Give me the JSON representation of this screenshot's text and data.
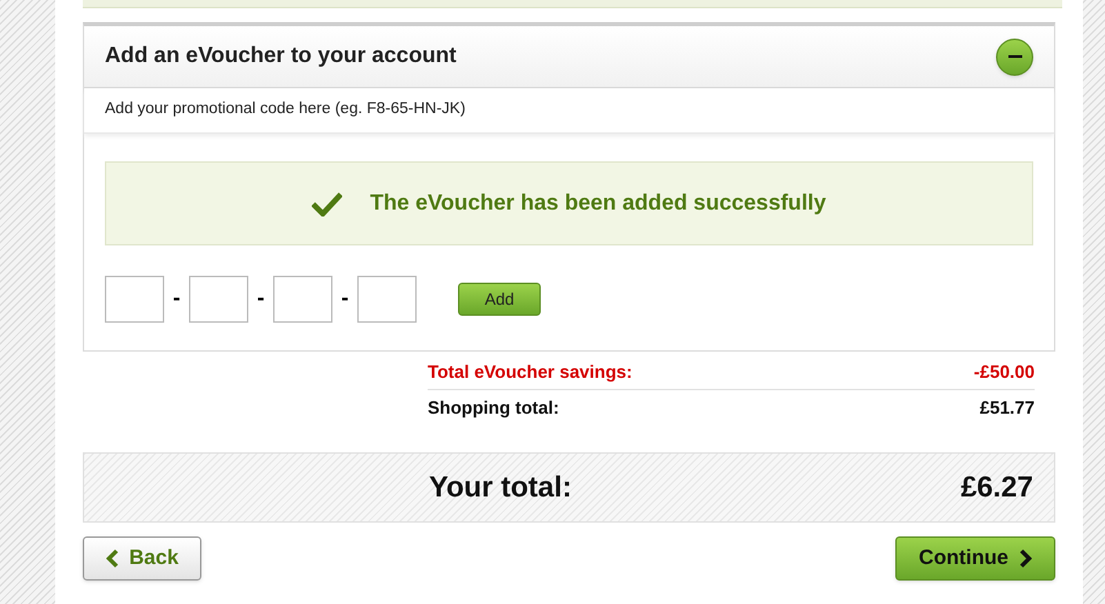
{
  "voucher_panel": {
    "title": "Add an eVoucher to your account",
    "expanded": true,
    "instruction": "Add your promotional code here (eg. F8-65-HN-JK)",
    "success_message": "The eVoucher has been added successfully",
    "code_separators": [
      "-",
      "-",
      "-"
    ],
    "add_button": "Add"
  },
  "summary_rows": [
    {
      "kind": "discount",
      "label": "Total eVoucher savings:",
      "value": "-£50.00"
    },
    {
      "kind": "normal",
      "label": "Shopping total:",
      "value": "£51.77"
    }
  ],
  "total": {
    "label": "Your total:",
    "value": "£6.27"
  },
  "buttons": {
    "back": "Back",
    "continue": "Continue"
  }
}
